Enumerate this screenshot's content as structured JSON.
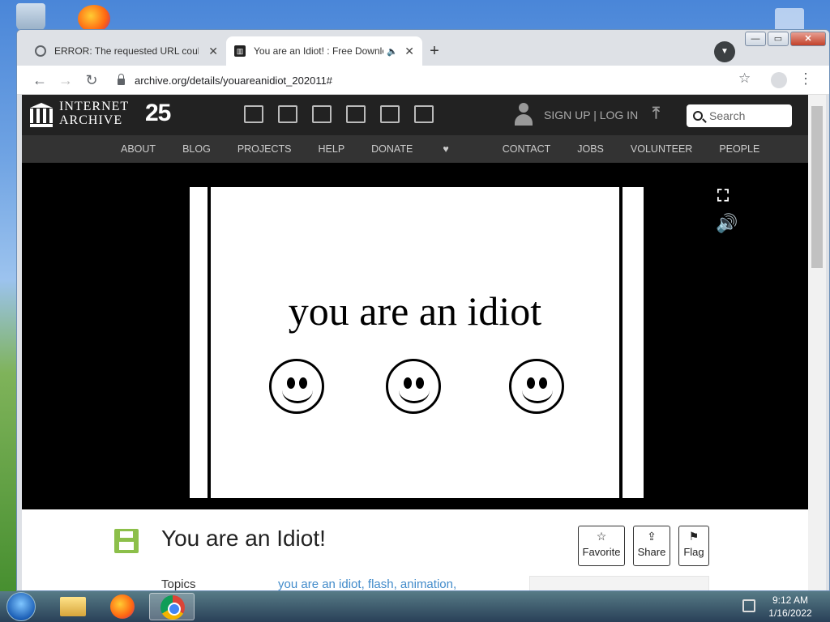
{
  "browser": {
    "tabs": [
      {
        "title": "ERROR: The requested URL could not be retrieved",
        "close": "✕"
      },
      {
        "title": "You are an Idiot! : Free Download",
        "close": "✕"
      }
    ],
    "new_tab": "+",
    "url": "archive.org/details/youareanidiot_202011#",
    "window_controls": {
      "minimize": "—",
      "maximize": "▭",
      "close": "✕"
    }
  },
  "site": {
    "logo_line1": "INTERNET",
    "logo_line2": "ARCHIVE",
    "anniversary": "25",
    "signup": "SIGN UP | LOG IN",
    "search_placeholder": "Search",
    "nav": [
      "ABOUT",
      "BLOG",
      "PROJECTS",
      "HELP",
      "DONATE",
      "CONTACT",
      "JOBS",
      "VOLUNTEER",
      "PEOPLE"
    ]
  },
  "player": {
    "text": "you are an idiot"
  },
  "item": {
    "title": "You are an Idiot!",
    "actions": {
      "favorite": "Favorite",
      "share": "Share",
      "flag": "Flag"
    },
    "topics_label": "Topics",
    "topics_value": "you are an idiot, flash, animation,"
  },
  "taskbar": {
    "time": "9:12 AM",
    "date": "1/16/2022"
  },
  "colors": {
    "ia_dark": "#222222",
    "ia_nav": "#333333",
    "link_blue": "#428bca",
    "floppy_green": "#8cbf4a",
    "donate_heart": "#e3343a"
  }
}
